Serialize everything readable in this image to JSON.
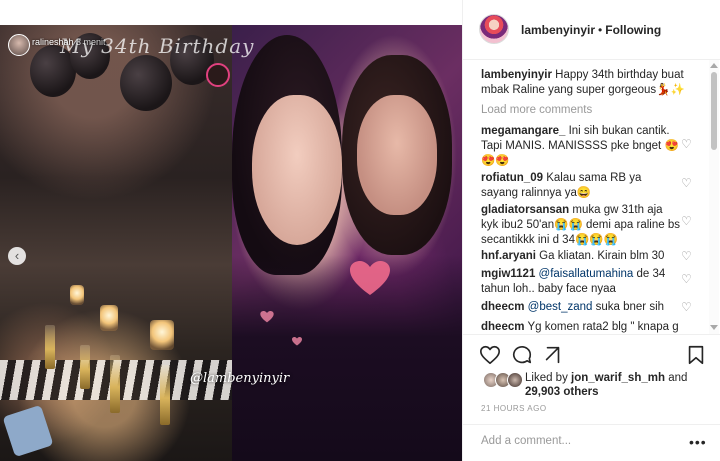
{
  "post": {
    "story_overlay": {
      "title": "My 34th Birthday",
      "username": "ralineshah",
      "time": "3 menit",
      "watermark": "@lambenyinyir"
    },
    "carousel": {
      "total": 2,
      "active": 2
    }
  },
  "header": {
    "username": "lambenyinyir",
    "separator": "•",
    "follow_state": "Following"
  },
  "caption": {
    "username": "lambenyinyir",
    "text": "Happy 34th birthday buat mbak Raline yang super gorgeous💃✨"
  },
  "load_more_label": "Load more comments",
  "comments": [
    {
      "username": "megamangare_",
      "text": "Ini sih bukan cantik. Tapi MANIS. MANISSSS pke bnget 😍😍😍"
    },
    {
      "username": "rofiatun_09",
      "text": "Kalau sama RB ya sayang ralinnya ya😄"
    },
    {
      "username": "gladiatorsansan",
      "text": "muka gw 31th aja kyk ibu2 50'an😭😭 demi apa raline bs secantikkk ini d 34😭😭😭"
    },
    {
      "username": "hnf.aryani",
      "text": "Ga kliatan. Kirain blm 30"
    },
    {
      "username": "mgiw1121",
      "mention": "@faisallatumahina",
      "text": "de 34 tahun loh.. baby face nyaa"
    },
    {
      "username": "dheecm",
      "mention": "@best_zand",
      "text": "suka bner sih"
    },
    {
      "username": "dheecm",
      "text": "Yg komen rata2 blg \" knapa g"
    }
  ],
  "likes": {
    "prefix": "Liked by",
    "user": "jon_warif_sh_mh",
    "conjunction": "and",
    "others": "29,903 others"
  },
  "timestamp": "21 HOURS AGO",
  "add_comment": {
    "placeholder": "Add a comment..."
  },
  "icons": {
    "like": "heart-icon",
    "comment": "comment-icon",
    "share": "share-icon",
    "save": "bookmark-icon",
    "more": "more-options-icon"
  },
  "colors": {
    "text": "#262626",
    "muted": "#999999",
    "mention": "#003569",
    "border": "#efefef",
    "media_background": "#0d0b10"
  }
}
